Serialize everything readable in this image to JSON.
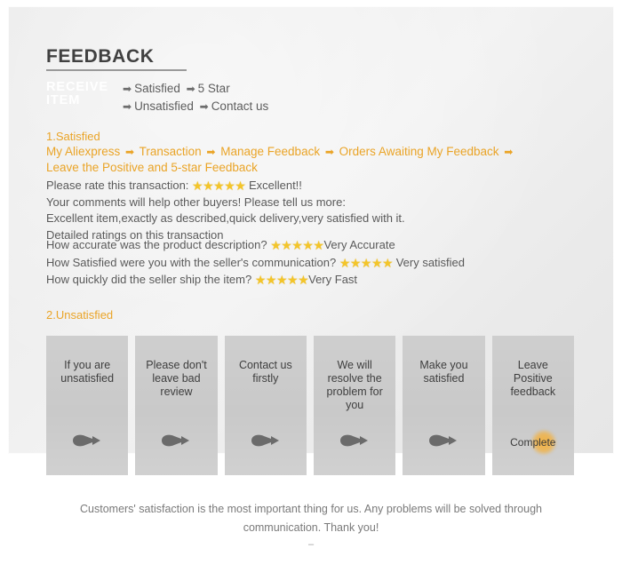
{
  "header": {
    "title": "FEEDBACK",
    "receive_item_label": "RECEIVE ITEM",
    "flow_rows": [
      {
        "arrow1": "➡",
        "step1": "Satisfied",
        "arrow2": "➡",
        "step2": "5 Star"
      },
      {
        "arrow1": "➡",
        "step1": "Unsatisfied",
        "arrow2": "➡",
        "step2": "Contact us"
      }
    ]
  },
  "section1": {
    "heading": "1.Satisfied",
    "breadcrumb": [
      "My Aliexpress",
      "Transaction",
      "Manage Feedback",
      "Orders Awaiting My Feedback",
      "Leave the Positive and 5-star Feedback"
    ],
    "breadcrumb_arrow": "➡",
    "rate_prompt": "Please rate this transaction:",
    "rate_stars": "★★★★★",
    "rate_value": "Excellent!!",
    "comments_prompt": "Your comments will help other buyers! Please tell us more:",
    "comment_text": "Excellent item,exactly as described,quick delivery,very satisfied with it.",
    "detailed_heading": "Detailed ratings on this transaction",
    "ratings": [
      {
        "question": "How accurate was the product description?",
        "stars": "★★★★★",
        "value": "Very Accurate"
      },
      {
        "question": "How Satisfied were you with the seller's communication?",
        "stars": "★★★★★",
        "value": " Very satisfied"
      },
      {
        "question": "How quickly did the seller ship the item?",
        "stars": "★★★★★",
        "value": "Very Fast"
      }
    ]
  },
  "section2": {
    "heading": "2.Unsatisfied",
    "steps": [
      {
        "label": "If you are unsatisfied",
        "icon": "comet-arrow-icon"
      },
      {
        "label": "Please don't leave bad review",
        "icon": "comet-arrow-icon"
      },
      {
        "label": "Contact us firstly",
        "icon": "comet-arrow-icon"
      },
      {
        "label": "We will resolve the problem for you",
        "icon": "comet-arrow-icon"
      },
      {
        "label": "Make you satisfied",
        "icon": "comet-arrow-icon"
      },
      {
        "label": "Leave Positive feedback",
        "icon": "complete-badge",
        "badge": "Complete"
      }
    ]
  },
  "footer": {
    "text": "Customers' satisfaction is the most important thing for us. Any problems will be solved through communication. Thank you!",
    "dash": "–"
  },
  "colors": {
    "accent_orange": "#eaa427",
    "star_yellow": "#f3c52a",
    "body_gray": "#5a5a5a",
    "box_gray": "#c9c9c9"
  }
}
